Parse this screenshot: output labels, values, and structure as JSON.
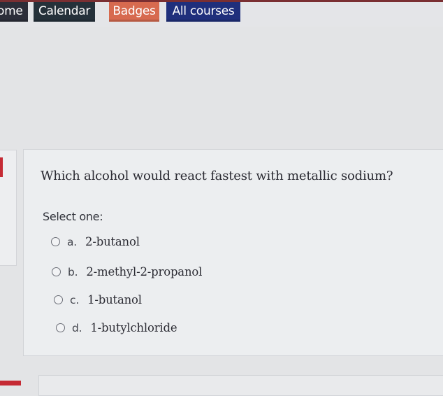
{
  "nav": {
    "home": "ome",
    "calendar": "Calendar",
    "badges": "Badges",
    "all_courses": "All courses"
  },
  "question": {
    "text": "Which alcohol would react fastest with metallic sodium?",
    "prompt": "Select one:",
    "options": [
      {
        "letter": "a.",
        "text": "2-butanol"
      },
      {
        "letter": "b.",
        "text": "2-methyl-2-propanol"
      },
      {
        "letter": "c.",
        "text": "1-butanol"
      },
      {
        "letter": "d.",
        "text": "1-butylchloride"
      }
    ]
  },
  "colors": {
    "nav_home": "#2c2e39",
    "nav_calendar": "#25313a",
    "nav_badges": "#d76a4f",
    "nav_courses": "#1f2f7c",
    "accent_red": "#c52a34"
  }
}
